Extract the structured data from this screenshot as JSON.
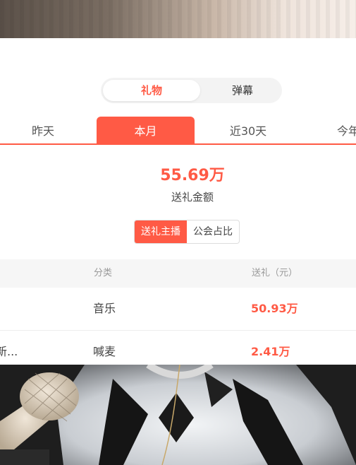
{
  "top_toggle": {
    "active": "礼物",
    "inactive": "弹幕"
  },
  "period_tabs": [
    "昨天",
    "本月",
    "近30天",
    "今年"
  ],
  "active_tab_index": 1,
  "summary": {
    "amount": "55.69万",
    "label": "送礼金额"
  },
  "segment": {
    "active": "送礼主播",
    "inactive": "公会占比"
  },
  "table": {
    "headers": {
      "category": "分类",
      "gift": "送礼（元）"
    },
    "rows": [
      {
        "name": "",
        "category": "音乐",
        "amount": "50.93万"
      },
      {
        "name": "新...",
        "category": "喊麦",
        "amount": "2.41万"
      }
    ]
  },
  "colors": {
    "accent": "#ff5a45",
    "header_bg": "#f6f6f6"
  }
}
